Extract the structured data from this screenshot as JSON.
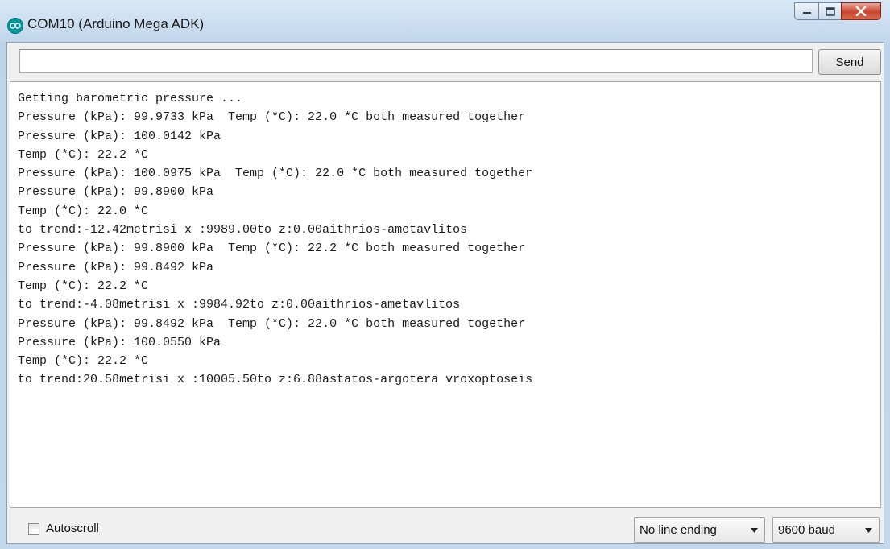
{
  "window": {
    "title": "COM10 (Arduino Mega ADK)",
    "controls": [
      "minimize-icon",
      "maximize-icon",
      "close-icon"
    ]
  },
  "send_bar": {
    "input_value": "",
    "send_label": "Send"
  },
  "output_lines": [
    "Getting barometric pressure ...",
    "Pressure (kPa): 99.9733 kPa  Temp (*C): 22.0 *C both measured together",
    "Pressure (kPa): 100.0142 kPa",
    "Temp (*C): 22.2 *C",
    "Pressure (kPa): 100.0975 kPa  Temp (*C): 22.0 *C both measured together",
    "Pressure (kPa): 99.8900 kPa",
    "Temp (*C): 22.0 *C",
    "to trend:-12.42metrisi x :9989.00to z:0.00aithrios-ametavlitos",
    "Pressure (kPa): 99.8900 kPa  Temp (*C): 22.2 *C both measured together",
    "Pressure (kPa): 99.8492 kPa",
    "Temp (*C): 22.2 *C",
    "to trend:-4.08metrisi x :9984.92to z:0.00aithrios-ametavlitos",
    "Pressure (kPa): 99.8492 kPa  Temp (*C): 22.0 *C both measured together",
    "Pressure (kPa): 100.0550 kPa",
    "Temp (*C): 22.2 *C",
    "to trend:20.58metrisi x :10005.50to z:6.88astatos-argotera vroxoptoseis"
  ],
  "footer": {
    "autoscroll_label": "Autoscroll",
    "autoscroll_checked": false,
    "line_ending": "No line ending",
    "baud_rate": "9600 baud"
  }
}
